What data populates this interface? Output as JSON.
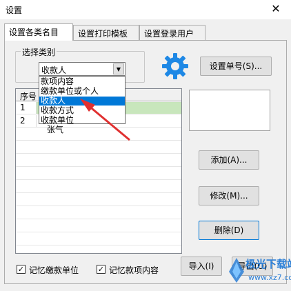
{
  "window": {
    "title": "设置",
    "close_glyph": "✕"
  },
  "tabs": [
    {
      "label": "设置各类名目",
      "active": true
    },
    {
      "label": "设置打印模板",
      "active": false
    },
    {
      "label": "设置登录用户",
      "active": false
    }
  ],
  "category": {
    "legend": "选择类别",
    "selected": "收款人",
    "dropdown_glyph": "▼",
    "options": [
      "款项内容",
      "缴款单位或个人",
      "收款人",
      "收款方式",
      "收款单位"
    ],
    "selected_index": 2
  },
  "grid": {
    "header_col1": "序号",
    "rows": [
      {
        "no": "1",
        "name": ""
      },
      {
        "no": "2",
        "name": ""
      }
    ],
    "partial_cell": "张气"
  },
  "buttons": {
    "set_number": "设置单号(S)...",
    "add": "添加(A)...",
    "modify": "修改(M)...",
    "delete": "删除(D)",
    "import": "导入(I)",
    "export": "导出(O)"
  },
  "checkboxes": [
    {
      "label": "记忆缴款单位",
      "checked": true,
      "mark": "✓"
    },
    {
      "label": "记忆款项内容",
      "checked": true,
      "mark": "✓"
    }
  ],
  "watermark": {
    "line1": "极光下载站",
    "line2": "www.xz7.com"
  },
  "colors": {
    "accent": "#0078d7",
    "gear": "#1e88e5",
    "row_highlight": "#c8e6bc",
    "annotation_arrow": "#e03030"
  },
  "icons": {
    "settings": "gear-icon",
    "close": "close-icon",
    "dropdown": "chevron-down-icon"
  }
}
